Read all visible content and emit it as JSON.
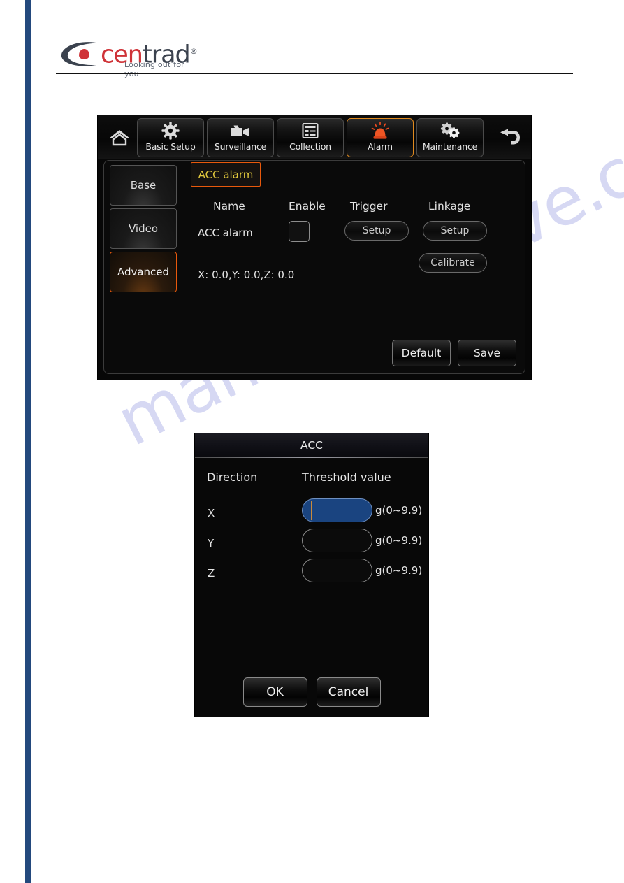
{
  "brand": {
    "name_part1": "cen",
    "name_part2": "trad",
    "registered": "®",
    "tagline": "Looking out for you",
    "colors": {
      "red": "#cf3338",
      "dark": "#3b424e",
      "spine_blue": "#23497d"
    }
  },
  "watermark": {
    "text": "manualsarchive.com",
    "color": "#cfd2f2"
  },
  "device": {
    "topbar": {
      "home_icon": "home-icon",
      "back_icon": "back-arrow-icon",
      "buttons": [
        {
          "label": "Basic Setup",
          "icon": "gear-icon",
          "active": false
        },
        {
          "label": "Surveillance",
          "icon": "video-camera-icon",
          "active": false
        },
        {
          "label": "Collection",
          "icon": "document-list-icon",
          "active": false
        },
        {
          "label": "Alarm",
          "icon": "alarm-siren-icon",
          "active": true
        },
        {
          "label": "Maintenance",
          "icon": "double-gear-icon",
          "active": false
        }
      ],
      "active_accent": "#e08a1e"
    },
    "side_tabs": [
      {
        "label": "Base",
        "active": false
      },
      {
        "label": "Video",
        "active": false
      },
      {
        "label": "Advanced",
        "active": true
      }
    ],
    "group_tab": {
      "label": "ACC alarm",
      "text_color": "#dfc63c",
      "border_color": "#e8590c"
    },
    "table": {
      "headers": {
        "name": "Name",
        "enable": "Enable",
        "trigger": "Trigger",
        "linkage": "Linkage"
      },
      "rows": [
        {
          "name": "ACC alarm",
          "enable_checked": false,
          "trigger_label": "Setup",
          "linkage_label": "Setup",
          "calibrate_label": "Calibrate"
        }
      ]
    },
    "readout": "X: 0.0,Y: 0.0,Z: 0.0",
    "footer": {
      "default_label": "Default",
      "save_label": "Save"
    }
  },
  "dialog": {
    "title": "ACC",
    "headers": {
      "direction": "Direction",
      "threshold": "Threshold value"
    },
    "rows": [
      {
        "axis": "X",
        "value": "",
        "unit": "g(0~9.9)",
        "selected": true
      },
      {
        "axis": "Y",
        "value": "",
        "unit": "g(0~9.9)",
        "selected": false
      },
      {
        "axis": "Z",
        "value": "",
        "unit": "g(0~9.9)",
        "selected": false
      }
    ],
    "selection_color": "#1a4480",
    "caret_color": "#c98a3c",
    "buttons": {
      "ok": "OK",
      "cancel": "Cancel"
    }
  }
}
